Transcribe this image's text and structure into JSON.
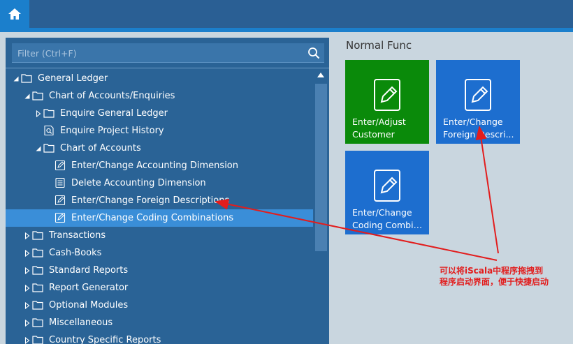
{
  "header": {
    "home_icon": "home-icon"
  },
  "filter": {
    "placeholder": "Filter (Ctrl+F)",
    "value": "",
    "search_icon": "search-icon"
  },
  "tree": {
    "items": [
      {
        "label": "General Ledger",
        "level": 0,
        "expanded": true,
        "icon": "folder-icon"
      },
      {
        "label": "Chart of Accounts/Enquiries",
        "level": 1,
        "expanded": true,
        "icon": "folder-icon"
      },
      {
        "label": "Enquire General Ledger",
        "level": 2,
        "expanded": false,
        "icon": "folder-icon"
      },
      {
        "label": "Enquire Project History",
        "level": 2,
        "icon": "magnifier-doc-icon"
      },
      {
        "label": "Chart of Accounts",
        "level": 2,
        "expanded": true,
        "icon": "folder-icon"
      },
      {
        "label": "Enter/Change Accounting Dimension",
        "level": 3,
        "icon": "edit-doc-icon"
      },
      {
        "label": "Delete Accounting Dimension",
        "level": 3,
        "icon": "list-doc-icon"
      },
      {
        "label": "Enter/Change Foreign Descriptions",
        "level": 3,
        "icon": "edit-doc-icon"
      },
      {
        "label": "Enter/Change Coding Combinations",
        "level": 3,
        "icon": "edit-doc-icon",
        "selected": true
      },
      {
        "label": "Transactions",
        "level": 1,
        "expanded": false,
        "icon": "folder-icon"
      },
      {
        "label": "Cash-Books",
        "level": 1,
        "expanded": false,
        "icon": "folder-icon"
      },
      {
        "label": "Standard Reports",
        "level": 1,
        "expanded": false,
        "icon": "folder-icon"
      },
      {
        "label": "Report Generator",
        "level": 1,
        "expanded": false,
        "icon": "folder-icon"
      },
      {
        "label": "Optional Modules",
        "level": 1,
        "expanded": false,
        "icon": "folder-icon"
      },
      {
        "label": "Miscellaneous",
        "level": 1,
        "expanded": false,
        "icon": "folder-icon"
      },
      {
        "label": "Country Specific Reports",
        "level": 1,
        "expanded": false,
        "icon": "folder-icon"
      }
    ]
  },
  "normal_func": {
    "title": "Normal Func",
    "tiles": [
      {
        "lines": [
          "Enter/Adjust",
          "Customer"
        ],
        "color": "#0a8a0a",
        "icon": "edit-doc-icon"
      },
      {
        "lines": [
          "Enter/Change",
          "Foreign Descri..."
        ],
        "color": "#1d6ecf",
        "icon": "edit-doc-icon"
      },
      {
        "lines": [
          "Enter/Change",
          "Coding Combin..."
        ],
        "color": "#1d6ecf",
        "icon": "edit-doc-icon"
      }
    ]
  },
  "annotation": {
    "lines": [
      "可以将iScala中程序拖拽到",
      "程序启动界面，便于快捷启动"
    ],
    "color": "#e21d1d"
  },
  "colors": {
    "topbar": "#2a5f94",
    "accent": "#1b7fcc",
    "panel": "#2a6396",
    "selected_row": "#3a8ed8",
    "background": "#c9d6df"
  }
}
